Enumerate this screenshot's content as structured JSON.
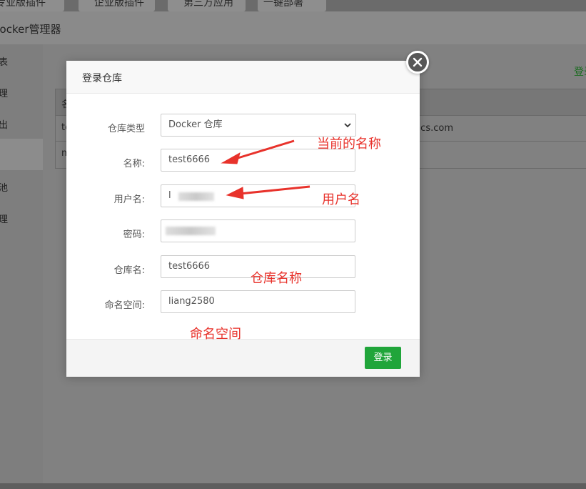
{
  "background": {
    "top_tabs": [
      "专业版插件",
      "企业版插件",
      "第三方应用",
      "一键部署"
    ],
    "app_title": "Docker管理器",
    "nav_items": [
      "表",
      "理",
      "出",
      "",
      "池",
      "理"
    ],
    "right_link": "登录",
    "table_row_text": "yuncs.com",
    "table_header_fragment": "名",
    "table_row_fragments": [
      "te",
      "m"
    ]
  },
  "modal": {
    "title": "登录仓库",
    "fields": {
      "repo_type": {
        "label": "仓库类型",
        "value": "Docker 仓库"
      },
      "name": {
        "label": "名称:",
        "value": "test6666"
      },
      "username": {
        "label": "用户名:",
        "value": "l"
      },
      "password": {
        "label": "密码:",
        "value": ""
      },
      "repo_name": {
        "label": "仓库名:",
        "value": "test6666"
      },
      "namespace": {
        "label": "命名空间:",
        "value": "liang2580"
      }
    },
    "submit_label": "登录"
  },
  "annotations": {
    "current_name": "当前的名称",
    "username": "用户名",
    "repo_name": "仓库名称",
    "namespace": "命名空间"
  },
  "colors": {
    "accent_green": "#20a53a",
    "annotation_red": "#e8322b",
    "overlay": "#7c7c7c"
  }
}
